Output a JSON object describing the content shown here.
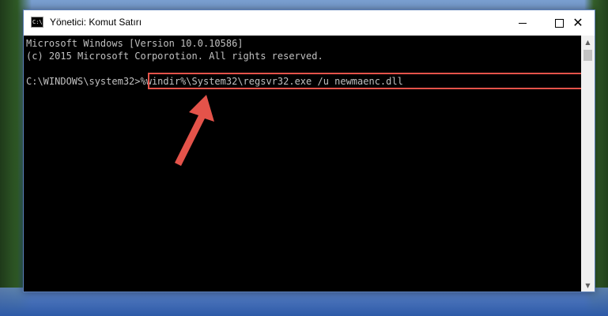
{
  "window": {
    "title": "Yönetici: Komut Satırı",
    "icon": "cmd-app-icon",
    "icon_text": "C:\\",
    "controls": {
      "minimize": "minimize-icon",
      "maximize": "maximize-icon",
      "close": "close-icon",
      "close_glyph": "✕"
    }
  },
  "console": {
    "lines": [
      "Microsoft Windows [Version 10.0.10586]",
      "(c) 2015 Microsoft Corporotion. All rights reserved."
    ],
    "prompt": "C:\\WINDOWS\\system32>",
    "command": "%windir%\\System32\\regsvr32.exe /u newmaenc.dll"
  },
  "colors": {
    "highlight": "#e4534a",
    "arrow": "#e4534a",
    "console_bg": "#000000",
    "console_text": "#c0c0c0"
  }
}
